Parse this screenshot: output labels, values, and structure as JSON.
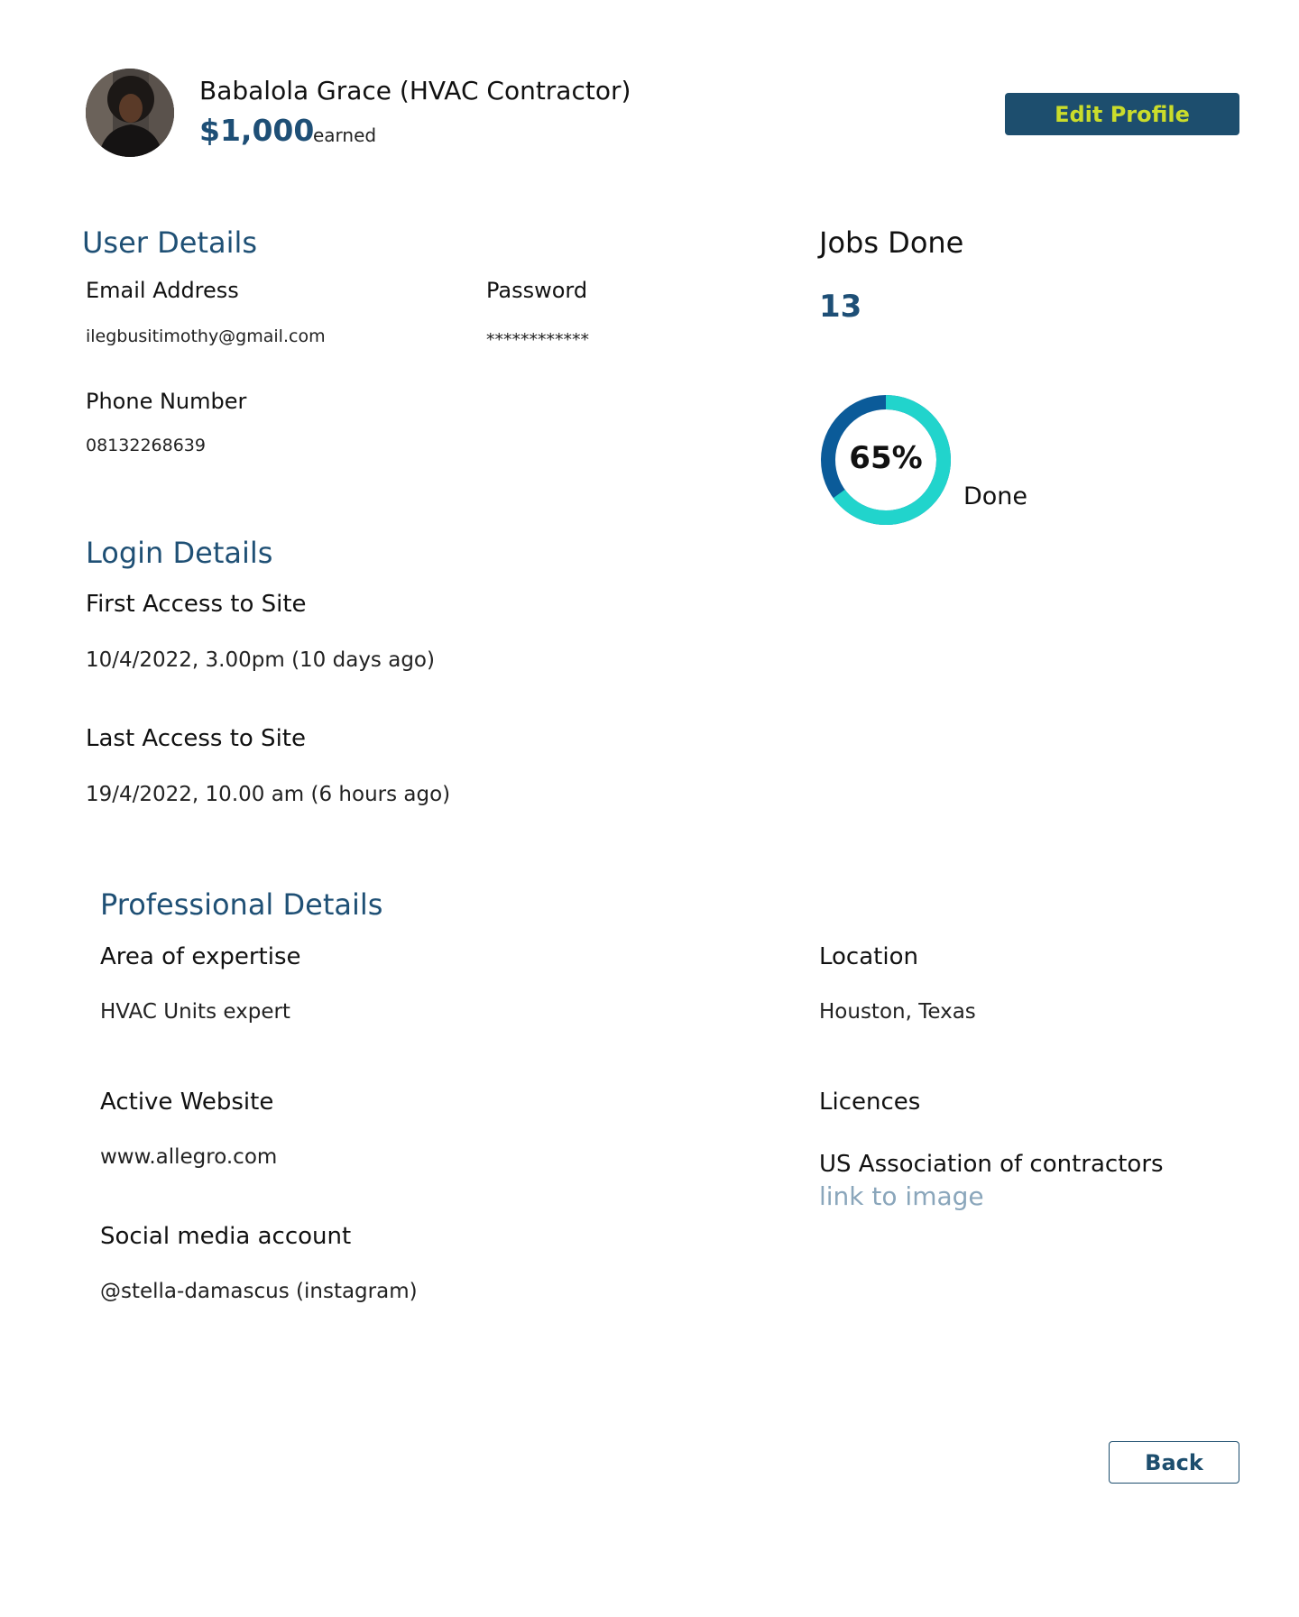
{
  "header": {
    "name": "Babalola Grace (HVAC Contractor)",
    "earned_amount": "$1,000",
    "earned_label": "earned",
    "edit_button": "Edit Profile"
  },
  "user_details": {
    "title": "User Details",
    "email_label": "Email Address",
    "email_value": "ilegbusitimothy@gmail.com",
    "password_label": "Password",
    "password_value": "************",
    "phone_label": "Phone Number",
    "phone_value": "08132268639"
  },
  "jobs": {
    "title": "Jobs Done",
    "count": "13",
    "percent_label": "65%",
    "percent_value": 0.65,
    "done_label": "Done",
    "ring_done_color": "#21d4cc",
    "ring_remaining_color": "#0b5b99"
  },
  "login_details": {
    "title": "Login Details",
    "first_access_label": "First Access to Site",
    "first_access_value": "10/4/2022, 3.00pm (10 days ago)",
    "last_access_label": "Last Access to Site",
    "last_access_value": "19/4/2022, 10.00 am (6 hours ago)"
  },
  "professional_details": {
    "title": "Professional Details",
    "expertise_label": "Area of expertise",
    "expertise_value": "HVAC Units expert",
    "location_label": "Location",
    "location_value": "Houston, Texas",
    "website_label": "Active Website",
    "website_value": "www.allegro.com",
    "licences_label": "Licences",
    "licence_name": "US Association of contractors",
    "licence_link": "link to image",
    "social_label": "Social media account",
    "social_value": "@stella-damascus (instagram)"
  },
  "footer": {
    "back_button": "Back"
  }
}
